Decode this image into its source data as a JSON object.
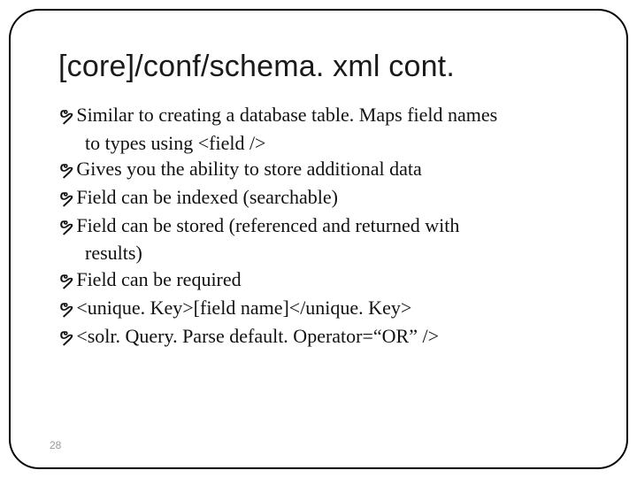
{
  "title": "[core]/conf/schema. xml cont.",
  "bullets": [
    {
      "line1": "Similar to creating a database table. Maps field names",
      "line2": "to types using <field />"
    },
    {
      "line1": "Gives you the ability to store additional data"
    },
    {
      "line1": "Field can be indexed (searchable)"
    },
    {
      "line1": "Field can be stored (referenced and returned with",
      "line2": "results)"
    },
    {
      "line1": "Field can be required"
    },
    {
      "line1": "<unique. Key>[field name]</unique. Key>"
    },
    {
      "line1": "<solr. Query. Parse default. Operator=“OR” />"
    }
  ],
  "bullet_glyph": "ຯ",
  "slide_number": "28"
}
